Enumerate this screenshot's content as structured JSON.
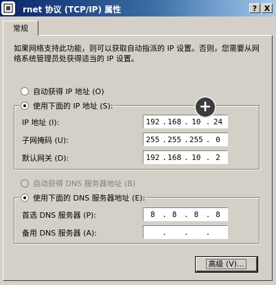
{
  "window": {
    "title": "rnet 协议 (TCP/IP) 属性",
    "help_label": "?",
    "close_label": "X"
  },
  "tabs": [
    {
      "label": "常规"
    }
  ],
  "description": "如果网络支持此功能，则可以获取自动指派的 IP 设置。否则，您需要从网络系统管理员处获得适当的 IP 设置。",
  "ip_section": {
    "auto_label": "自动获得 IP 地址 (O)",
    "manual_label": "使用下面的 IP 地址 (S):",
    "selected": "manual",
    "fields": [
      {
        "label": "IP 地址 (I):",
        "value": [
          "192",
          "168",
          "10",
          "24"
        ]
      },
      {
        "label": "子网掩码 (U):",
        "value": [
          "255",
          "255",
          "255",
          "0"
        ]
      },
      {
        "label": "默认网关 (D):",
        "value": [
          "192",
          "168",
          "10",
          "2"
        ]
      }
    ]
  },
  "dns_section": {
    "auto_label": "自动获得 DNS 服务器地址 (B)",
    "manual_label": "使用下面的 DNS 服务器地址 (E):",
    "selected": "manual",
    "fields": [
      {
        "label": "首选 DNS 服务器 (P):",
        "value": [
          "8",
          "8",
          "8",
          "8"
        ]
      },
      {
        "label": "备用 DNS 服务器 (A):",
        "value": [
          "",
          "",
          "",
          ""
        ]
      }
    ]
  },
  "advanced_button": {
    "label": "高级 (V)..."
  },
  "overlay": {
    "plus_symbol": "+"
  }
}
